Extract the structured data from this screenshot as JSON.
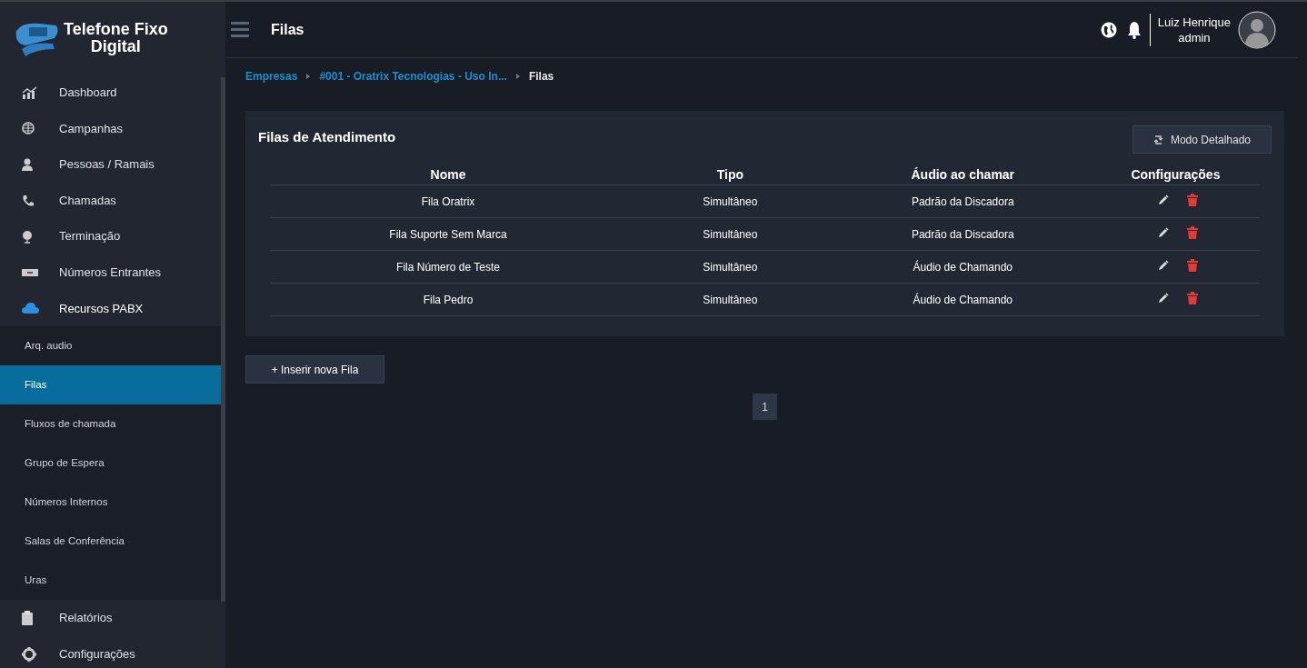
{
  "sidebar": {
    "logo": {
      "line1": "Telefone Fixo",
      "line2": "Digital"
    },
    "items": [
      {
        "label": "Dashboard",
        "expanded": false
      },
      {
        "label": "Campanhas",
        "expanded": false
      },
      {
        "label": "Pessoas / Ramais",
        "expanded": false
      },
      {
        "label": "Chamadas",
        "expanded": false
      },
      {
        "label": "Terminação",
        "expanded": false
      },
      {
        "label": "Números Entrantes",
        "expanded": false
      },
      {
        "label": "Recursos PABX",
        "expanded": true,
        "children": [
          {
            "label": "Arq. audio",
            "selected": false
          },
          {
            "label": "Filas",
            "selected": true
          },
          {
            "label": "Fluxos de chamada",
            "selected": false
          },
          {
            "label": "Grupo de Espera",
            "selected": false
          },
          {
            "label": "Números Internos",
            "selected": false
          },
          {
            "label": "Salas de Conferência",
            "selected": false
          },
          {
            "label": "Uras",
            "selected": false
          }
        ]
      },
      {
        "label": "Relatórios",
        "expanded": false
      },
      {
        "label": "Configurações",
        "expanded": false
      }
    ]
  },
  "header": {
    "title": "Filas",
    "user": {
      "name": "Luiz Henrique",
      "role": "admin"
    }
  },
  "breadcrumb": [
    {
      "label": "Empresas",
      "link": true
    },
    {
      "label": "#001 - Oratrix Tecnologias - Uso In...",
      "link": true
    },
    {
      "label": "Filas",
      "link": false
    }
  ],
  "card": {
    "title": "Filas de Atendimento",
    "mode_button": "Modo Detalhado",
    "table": {
      "columns": [
        "Nome",
        "Tipo",
        "Áudio ao chamar",
        "Configurações"
      ],
      "rows": [
        [
          "Fila Oratrix",
          "Simultâneo",
          "Padrão da Discadora"
        ],
        [
          "Fila Suporte Sem Marca",
          "Simultâneo",
          "Padrão da Discadora"
        ],
        [
          "Fila Número de Teste",
          "Simultâneo",
          "Áudio de Chamando"
        ],
        [
          "Fila Pedro",
          "Simultâneo",
          "Áudio de Chamando"
        ]
      ]
    }
  },
  "add_button": "+ Inserir nova Fila",
  "pagination": [
    {
      "label": "1",
      "selected": true
    }
  ]
}
